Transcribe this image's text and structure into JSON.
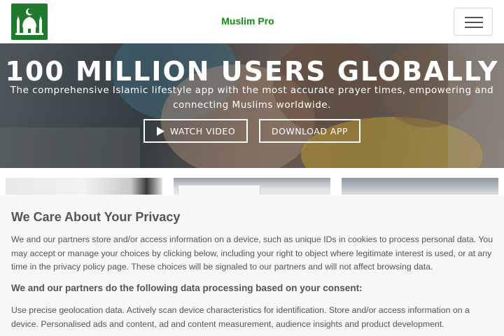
{
  "navbar": {
    "brand": "Muslim Pro",
    "logo_icon": "mosque-icon",
    "menu_icon": "hamburger-menu-icon"
  },
  "hero": {
    "title": "100 MILLION USERS GLOBALLY",
    "subtitle": "The comprehensive Islamic lifestyle app with the most accurate prayer times, empowering and connecting Muslims worldwide.",
    "watch_label": "WATCH VIDEO",
    "download_label": "DOWNLOAD APP",
    "play_icon": "play-icon"
  },
  "privacy": {
    "title": "We Care About Your Privacy",
    "body": "We and our partners store and/or access information on a device, such as unique IDs in cookies to process personal data. You may accept or manage your choices by clicking below, including your right to object where legitimate interest is used, or at any time in the privacy policy page. These choices will be signaled to our partners and will not affect browsing data.",
    "subtitle": "We and our partners do the following data processing based on your consent:",
    "purposes": "Use precise geolocation data. Actively scan device characteristics for identification. Store and/or access information on a device. Personalised ads and content, ad and content measurement, audience insights and product development."
  },
  "colors": {
    "brand_green": "#138a16",
    "logo_green": "#1f7a2e",
    "dialog_bg": "#f7f7f7",
    "dialog_text": "#555555"
  }
}
